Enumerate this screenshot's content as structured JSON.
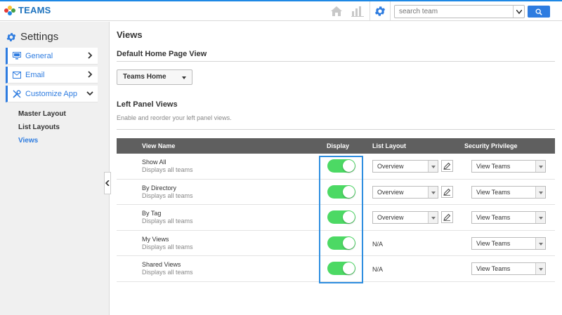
{
  "app": {
    "title": "TEAMS"
  },
  "search": {
    "placeholder": "search team"
  },
  "sidebar": {
    "title": "Settings",
    "items": [
      {
        "label": "General",
        "icon": "monitor-icon"
      },
      {
        "label": "Email",
        "icon": "envelope-icon"
      },
      {
        "label": "Customize App",
        "icon": "tools-icon",
        "expanded": true
      }
    ],
    "subitems": [
      {
        "label": "Master Layout",
        "active": false
      },
      {
        "label": "List Layouts",
        "active": false
      },
      {
        "label": "Views",
        "active": true
      }
    ]
  },
  "main": {
    "title": "Views",
    "home_section": {
      "title": "Default Home Page View",
      "selected": "Teams Home"
    },
    "left_panel": {
      "title": "Left Panel Views",
      "description": "Enable and reorder your left panel views."
    },
    "table": {
      "headers": {
        "view_name": "View Name",
        "display": "Display",
        "list_layout": "List Layout",
        "security": "Security Privilege"
      },
      "rows": [
        {
          "name": "Show All",
          "desc": "Displays all teams",
          "display": true,
          "list_layout": "Overview",
          "security": "View Teams"
        },
        {
          "name": "By Directory",
          "desc": "Displays all teams",
          "display": true,
          "list_layout": "Overview",
          "security": "View Teams"
        },
        {
          "name": "By Tag",
          "desc": "Displays all teams",
          "display": true,
          "list_layout": "Overview",
          "security": "View Teams"
        },
        {
          "name": "My Views",
          "desc": "Displays all teams",
          "display": true,
          "list_layout": "N/A",
          "security": "View Teams"
        },
        {
          "name": "Shared Views",
          "desc": "Displays all teams",
          "display": true,
          "list_layout": "N/A",
          "security": "View Teams"
        }
      ]
    }
  },
  "colors": {
    "accent": "#2e7ce0",
    "toggle_on": "#4cd964",
    "header_bg": "#5f5f5f",
    "highlight": "#2e8ee0"
  }
}
